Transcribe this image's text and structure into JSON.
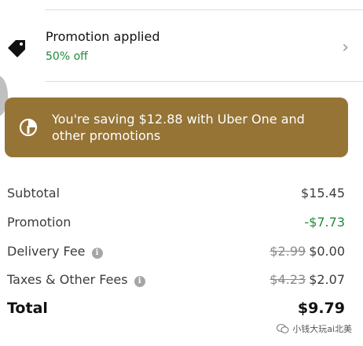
{
  "promotion": {
    "title": "Promotion applied",
    "subtitle": "50% off",
    "chevron": "›"
  },
  "banner": {
    "text": "You're saving $12.88 with Uber One and other promotions"
  },
  "summary": {
    "subtotal_label": "Subtotal",
    "subtotal_value": "$15.45",
    "promotion_label": "Promotion",
    "promotion_value": "-$7.73",
    "delivery_label": "Delivery Fee",
    "delivery_original": "$2.99",
    "delivery_value": "$0.00",
    "taxes_label": "Taxes & Other Fees",
    "taxes_original": "$4.23",
    "taxes_value": "$2.07",
    "total_label": "Total",
    "total_value": "$9.79",
    "info_glyph": "i"
  },
  "watermark": {
    "text": "小钱大玩ai北美"
  },
  "colors": {
    "banner": "#957436",
    "discount": "#1f8a3a"
  },
  "icons": {
    "promotion": "tag-icon",
    "banner": "uber-one-icon",
    "info": "info-icon",
    "watermark": "wechat-icon"
  }
}
